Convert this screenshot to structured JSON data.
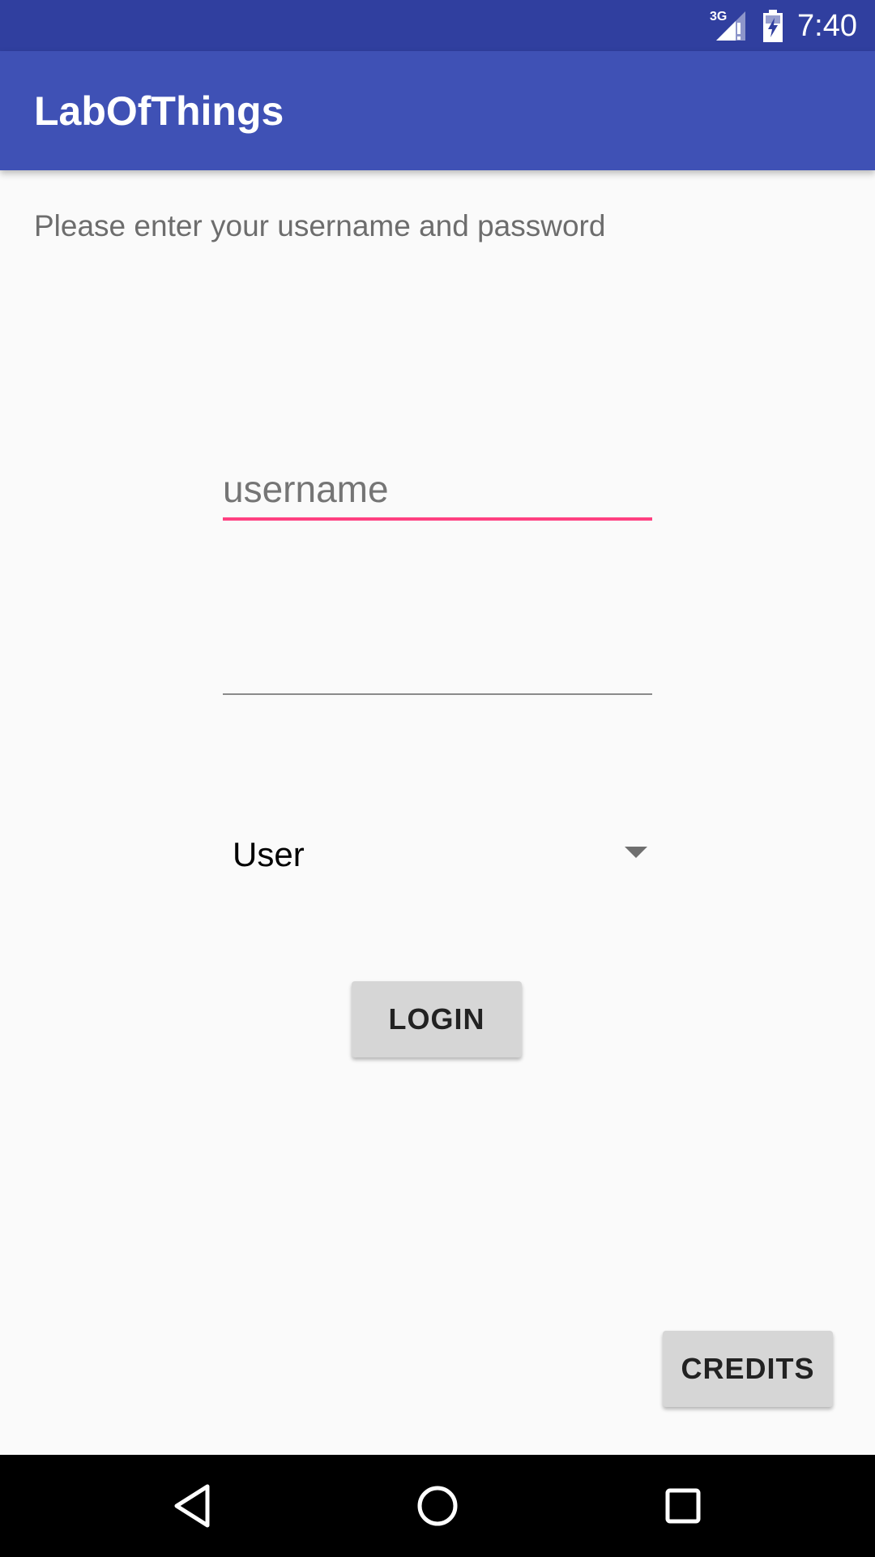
{
  "status_bar": {
    "network_label": "3G",
    "time": "7:40",
    "icons": [
      "signal-icon",
      "battery-charging-icon"
    ]
  },
  "app_bar": {
    "title": "LabOfThings"
  },
  "login_form": {
    "instruction": "Please enter your username and password",
    "username": {
      "value": "",
      "placeholder": "username"
    },
    "password": {
      "value": "",
      "placeholder": ""
    },
    "role_spinner": {
      "selected": "User"
    },
    "login_label": "LOGIN"
  },
  "credits_label": "CREDITS",
  "nav_bar": {
    "icons": [
      "back-icon",
      "home-icon",
      "recents-icon"
    ]
  },
  "colors": {
    "status_bar": "#303f9f",
    "app_bar": "#3f51b5",
    "accent": "#ff4081",
    "background": "#fafafa",
    "button": "#d6d6d6"
  }
}
